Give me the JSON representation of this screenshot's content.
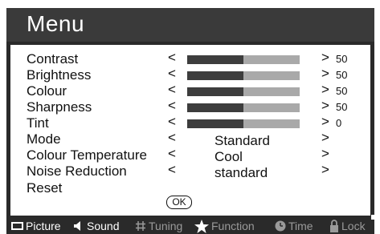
{
  "menu": {
    "title": "Menu"
  },
  "settings": {
    "contrast": {
      "label": "Contrast",
      "left": "<",
      "right": ">",
      "value": "50",
      "level": 0.5
    },
    "brightness": {
      "label": "Brightness",
      "left": "<",
      "right": ">",
      "value": "50",
      "level": 0.5
    },
    "colour": {
      "label": "Colour",
      "left": "<",
      "right": ">",
      "value": "50",
      "level": 0.5
    },
    "sharpness": {
      "label": "Sharpness",
      "left": "<",
      "right": ">",
      "value": "50",
      "level": 0.5
    },
    "tint": {
      "label": "Tint",
      "left": "<",
      "right": ">",
      "value": "0",
      "level": 0.5
    },
    "mode": {
      "label": "Mode",
      "left": "<",
      "right": ">",
      "value": "Standard"
    },
    "colour_temperature": {
      "label": "Colour Temperature",
      "left": "<",
      "right": ">",
      "value": "Cool"
    },
    "noise_reduction": {
      "label": "Noise Reduction",
      "left": "<",
      "right": ">",
      "value": "standard"
    },
    "reset": {
      "label": "Reset",
      "button": "OK"
    }
  },
  "tabs": [
    {
      "label": "Picture",
      "icon": "picture-icon",
      "active": true
    },
    {
      "label": "Sound",
      "icon": "speaker-icon",
      "active": false
    },
    {
      "label": "Tuning",
      "icon": "hash-icon",
      "active": false
    },
    {
      "label": "Function",
      "icon": "star-icon",
      "active": false
    },
    {
      "label": "Time",
      "icon": "clock-icon",
      "active": false
    },
    {
      "label": "Lock",
      "icon": "lock-icon",
      "active": false
    }
  ],
  "colors": {
    "frame": "#2a2a2a",
    "bar_track": "#a9a9a9",
    "bar_fill": "#3d3d3d",
    "tab_inactive": "#9a9a9a",
    "tab_active": "#ffffff"
  }
}
